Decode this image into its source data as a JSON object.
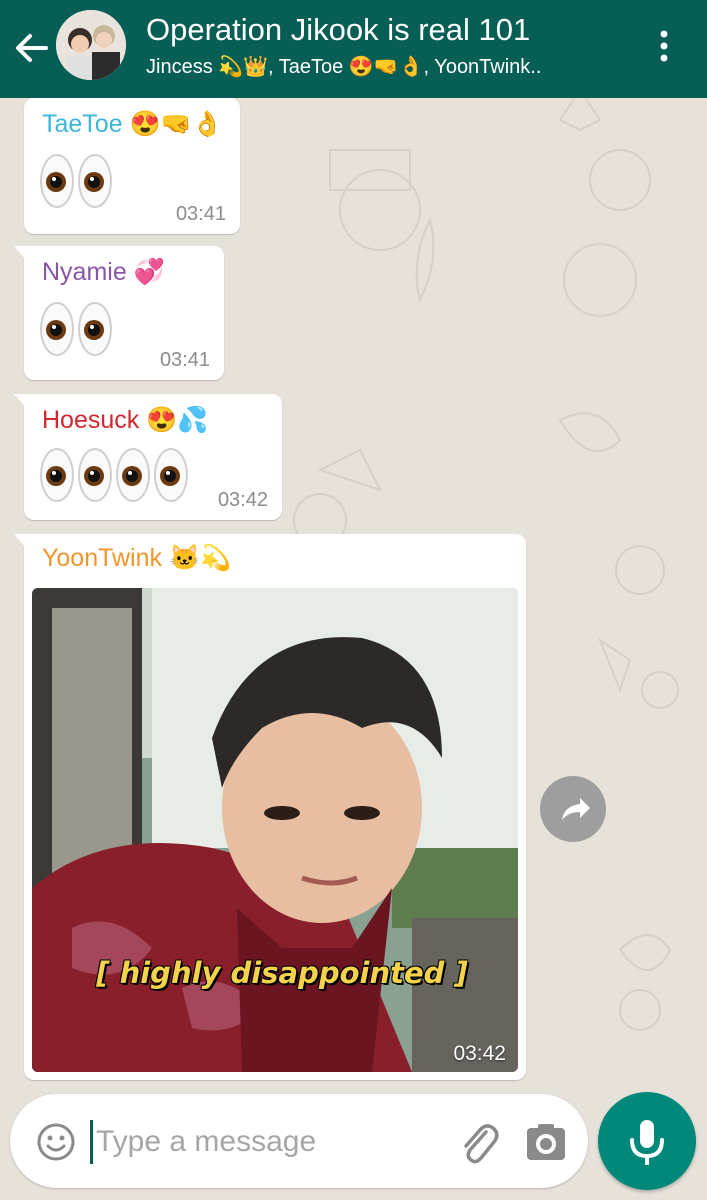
{
  "header": {
    "title": "Operation Jikook is real 101",
    "subtitle": "Jincess 💫👑, TaeToe 😍🤜👌, YoonTwink..",
    "bg_color": "#075e54"
  },
  "messages": [
    {
      "sender": "TaeToe 😍🤜👌",
      "sender_color": "#3bb7d9",
      "eyes": 2,
      "time": "03:41"
    },
    {
      "sender": "Nyamie 💞",
      "sender_color": "#8a55a7",
      "eyes": 2,
      "time": "03:41"
    },
    {
      "sender": "Hoesuck 😍💦",
      "sender_color": "#d3282f",
      "eyes": 4,
      "time": "03:42"
    },
    {
      "sender": "YoonTwink 🐱💫",
      "sender_color": "#f0962c",
      "image_caption": "[ highly disappointed ]",
      "time": "03:42"
    }
  ],
  "composer": {
    "placeholder": "Type a message",
    "emoji_icon": "smiley-icon",
    "attach_icon": "paperclip-icon",
    "camera_icon": "camera-icon",
    "mic_icon": "mic-icon",
    "accent": "#00897b"
  }
}
